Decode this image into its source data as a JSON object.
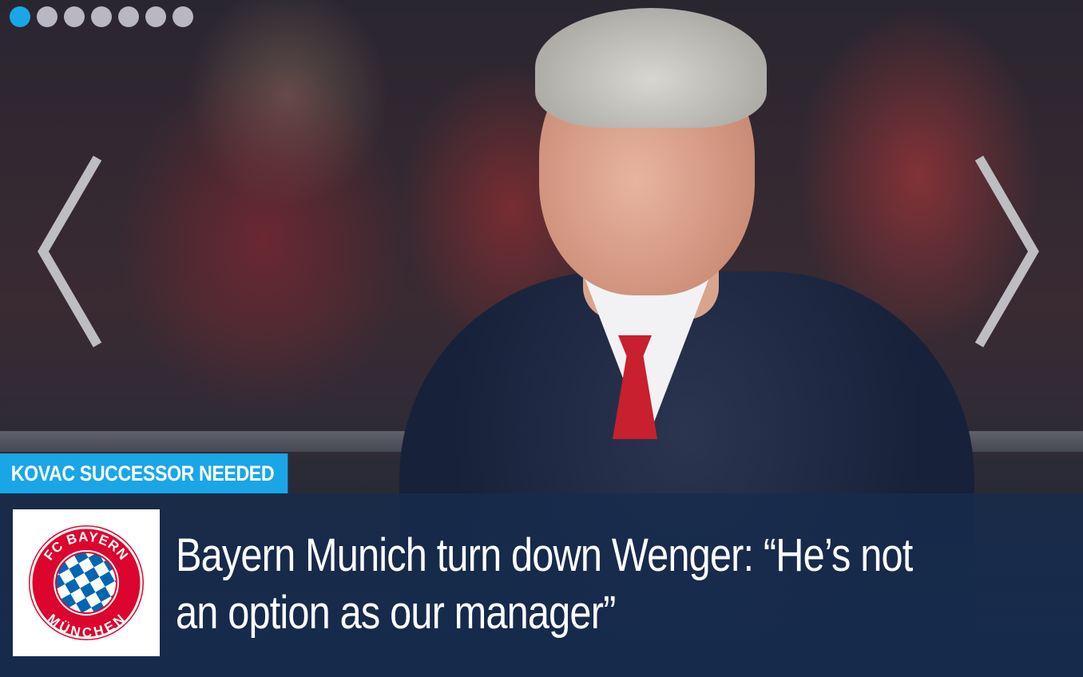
{
  "slider": {
    "dots": [
      {
        "active": true
      },
      {
        "active": false
      },
      {
        "active": false
      },
      {
        "active": false
      },
      {
        "active": false
      },
      {
        "active": false
      },
      {
        "active": false
      }
    ],
    "prev_icon": "chevron-left-icon",
    "next_icon": "chevron-right-icon"
  },
  "slide": {
    "tag": "KOVAC SUCCESSOR NEEDED",
    "headline": "Bayern Munich turn down Wenger: “He’s not an option as our manager”",
    "logo": {
      "name": "fc-bayern-munchen-logo",
      "text_top": "FC BAYERN",
      "text_bottom": "MÜNCHEN"
    }
  },
  "colors": {
    "accent": "#1aa6e6",
    "caption_bg": "#162b4d",
    "bayern_red": "#dc052d",
    "bayern_blue": "#0066b2"
  }
}
